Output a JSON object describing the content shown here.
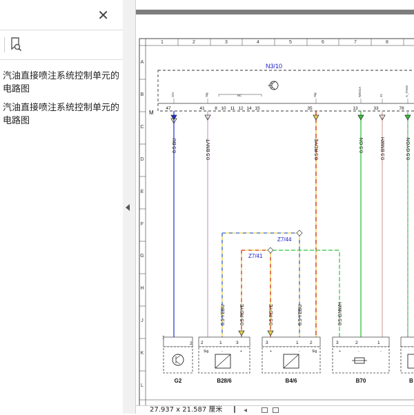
{
  "sidebar": {
    "close_glyph": "✕",
    "bookmarks": [
      {
        "label": "汽油直接喷注系统控制单元的电路图"
      },
      {
        "label": "汽油直接喷注系统控制单元的电路图"
      }
    ]
  },
  "document": {
    "grid_columns": [
      "1",
      "2",
      "3",
      "4",
      "5",
      "6",
      "7",
      "8"
    ],
    "grid_rows": [
      "A",
      "B",
      "C",
      "D",
      "E",
      "F",
      "G",
      "H",
      "J",
      "K",
      "L"
    ],
    "ecu_label": "N3/10",
    "ecu_marker": "M",
    "ecu_pin_tags": [
      "GN",
      "Sig",
      "NC",
      "Sig",
      "IWDGA",
      "31",
      "A_TANS"
    ],
    "ecu_pins": [
      "47",
      "41",
      "8",
      "10",
      "11",
      "12",
      "14",
      "15",
      "35",
      "13",
      "33",
      "78"
    ],
    "wire_labels": [
      "0.5 BU",
      "0.5 BNVT",
      "0.5 RDYE",
      "0.5 GN",
      "0.5 BNWH",
      "0.5 GYGN"
    ],
    "junctions": [
      "Z7/44",
      "Z7/41"
    ],
    "lower_wire_labels": [
      "0.5 YEBU",
      "0.5 RDYE",
      "0.5 RDYE",
      "0.5 YEBU",
      "0.5 GNWH"
    ],
    "components": [
      {
        "name": "G2",
        "pins": [
          "1",
          "2"
        ]
      },
      {
        "name": "B28/6",
        "pins": [
          "2",
          "1",
          "3"
        ],
        "signals": [
          "Sig",
          "-",
          "+"
        ]
      },
      {
        "name": "B4/6",
        "pins": [
          "3",
          "1",
          "2"
        ],
        "signals": [
          "+",
          "-",
          "Sig"
        ]
      },
      {
        "name": "B70",
        "pins": [
          "3",
          "2",
          "1"
        ],
        "signals": [
          "+",
          "-",
          "-"
        ]
      },
      {
        "name": "B"
      }
    ]
  },
  "status": {
    "page_size": "27.937 x 21.587 厘米"
  },
  "colors": {
    "blue": "#1f2fd0",
    "violet": "#c9a0c9",
    "rdye_red": "#d63a2a",
    "rdye_yellow": "#e8d04a",
    "green": "#2ec23c",
    "brown": "#b98a7a",
    "label_blue": "#1414c8"
  }
}
